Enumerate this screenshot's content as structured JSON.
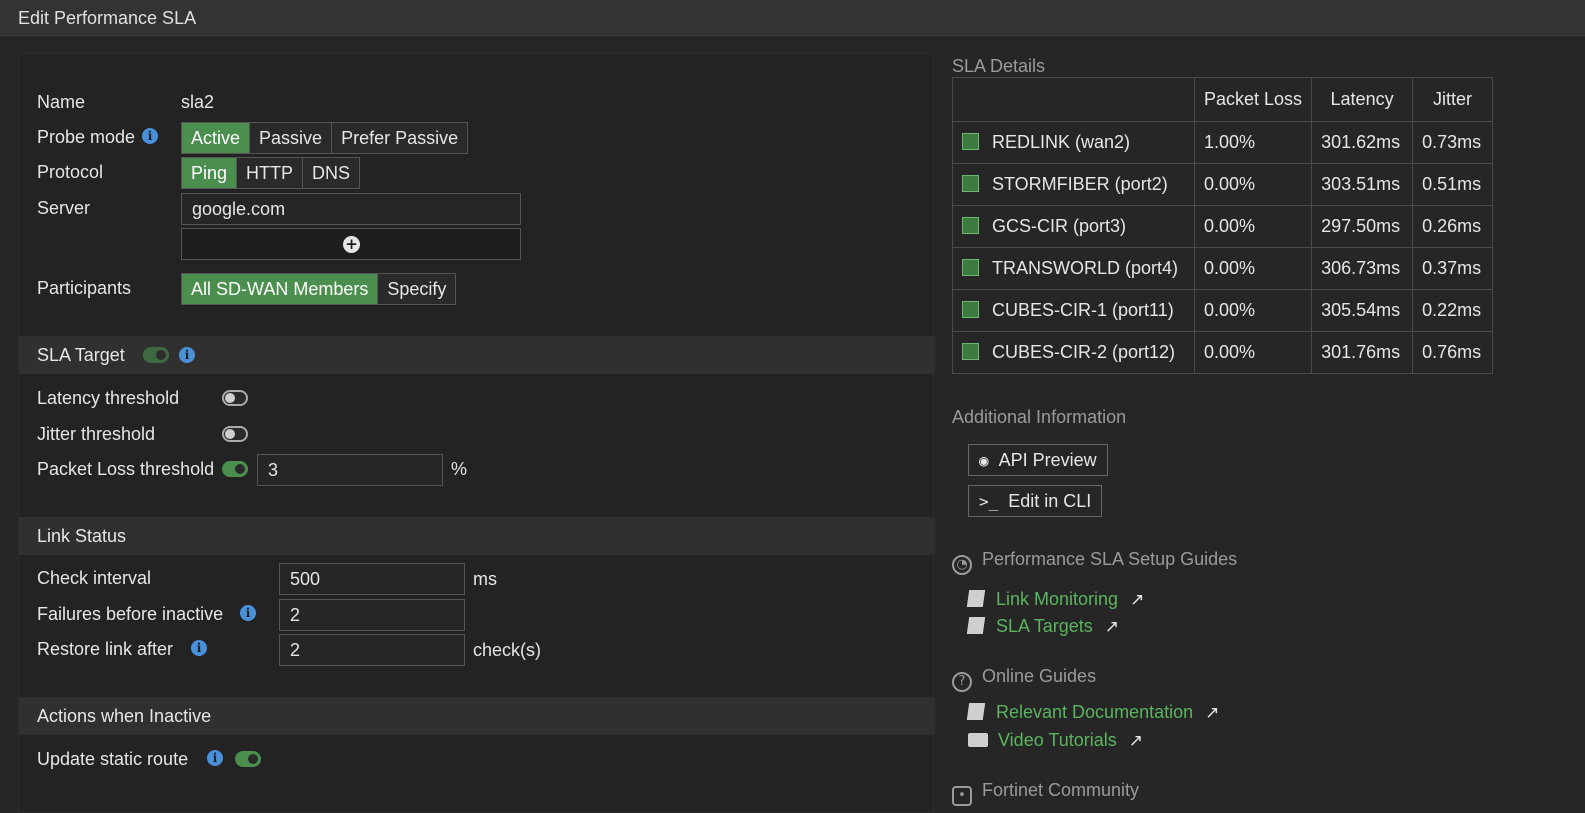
{
  "window": {
    "title": "Edit Performance SLA"
  },
  "form": {
    "name_label": "Name",
    "name_value": "sla2",
    "probe_mode_label": "Probe mode",
    "probe_modes": [
      "Active",
      "Passive",
      "Prefer Passive"
    ],
    "probe_mode_selected": "Active",
    "protocol_label": "Protocol",
    "protocols": [
      "Ping",
      "HTTP",
      "DNS"
    ],
    "protocol_selected": "Ping",
    "server_label": "Server",
    "server_value": "google.com",
    "participants_label": "Participants",
    "participants": [
      "All SD-WAN Members",
      "Specify"
    ],
    "participants_selected": "All SD-WAN Members"
  },
  "sla_target": {
    "title": "SLA Target",
    "enabled": true,
    "latency_label": "Latency threshold",
    "latency_enabled": false,
    "jitter_label": "Jitter threshold",
    "jitter_enabled": false,
    "packet_loss_label": "Packet Loss threshold",
    "packet_loss_enabled": true,
    "packet_loss_value": "3",
    "packet_loss_unit": "%"
  },
  "link_status": {
    "title": "Link Status",
    "check_interval_label": "Check interval",
    "check_interval_value": "500",
    "check_interval_unit": "ms",
    "failures_label": "Failures before inactive",
    "failures_value": "2",
    "restore_label": "Restore link after",
    "restore_value": "2",
    "restore_unit": "check(s)"
  },
  "actions": {
    "title": "Actions when Inactive",
    "update_static_route_label": "Update static route",
    "update_static_route_enabled": true
  },
  "sla_details": {
    "title": "SLA Details",
    "columns": [
      "",
      "Packet Loss",
      "Latency",
      "Jitter"
    ],
    "rows": [
      {
        "interface": "REDLINK (wan2)",
        "packet_loss": "1.00%",
        "latency": "301.62ms",
        "jitter": "0.73ms"
      },
      {
        "interface": "STORMFIBER (port2)",
        "packet_loss": "0.00%",
        "latency": "303.51ms",
        "jitter": "0.51ms"
      },
      {
        "interface": "GCS-CIR (port3)",
        "packet_loss": "0.00%",
        "latency": "297.50ms",
        "jitter": "0.26ms"
      },
      {
        "interface": "TRANSWORLD (port4)",
        "packet_loss": "0.00%",
        "latency": "306.73ms",
        "jitter": "0.37ms"
      },
      {
        "interface": "CUBES-CIR-1 (port11)",
        "packet_loss": "0.00%",
        "latency": "305.54ms",
        "jitter": "0.22ms"
      },
      {
        "interface": "CUBES-CIR-2 (port12)",
        "packet_loss": "0.00%",
        "latency": "301.76ms",
        "jitter": "0.76ms"
      }
    ]
  },
  "additional_info": {
    "title": "Additional Information",
    "api_preview_label": "API Preview",
    "edit_cli_label": "Edit in CLI"
  },
  "setup_guides": {
    "title": "Performance SLA Setup Guides",
    "links": [
      "Link Monitoring",
      "SLA Targets"
    ]
  },
  "online_guides": {
    "title": "Online Guides",
    "links": [
      "Relevant Documentation",
      "Video Tutorials"
    ]
  },
  "community": {
    "title": "Fortinet Community"
  },
  "colors": {
    "accent_green": "#4a8f4d",
    "link_green": "#5ab55e",
    "info_blue": "#4a90d9"
  }
}
